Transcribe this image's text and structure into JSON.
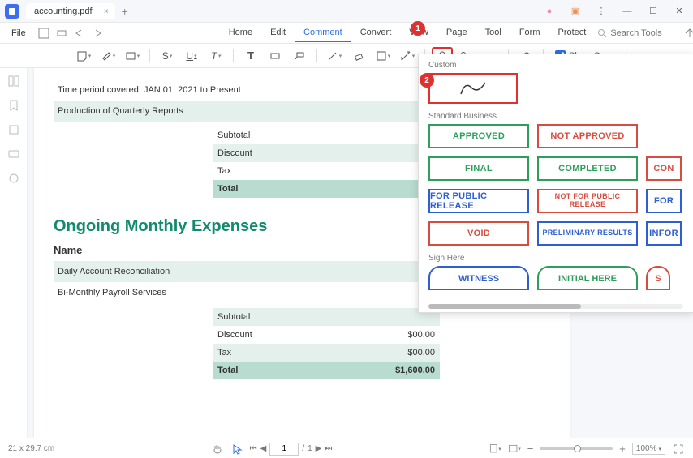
{
  "titlebar": {
    "tab_name": "accounting.pdf"
  },
  "menubar": {
    "file": "File",
    "items": [
      "Home",
      "Edit",
      "Comment",
      "Convert",
      "View",
      "Page",
      "Tool",
      "Form",
      "Protect"
    ],
    "active_index": 2,
    "search_placeholder": "Search Tools"
  },
  "toolbar": {
    "show_comment_label": "Show Comment"
  },
  "callouts": {
    "c1": "1",
    "c2": "2"
  },
  "stamp_panel": {
    "custom_label": "Custom",
    "standard_label": "Standard Business",
    "stamps_row1": [
      {
        "text": "APPROVED",
        "color": "#2e9e5b"
      },
      {
        "text": "NOT APPROVED",
        "color": "#d84c3f"
      }
    ],
    "stamps_row2": [
      {
        "text": "FINAL",
        "color": "#2e9e5b"
      },
      {
        "text": "COMPLETED",
        "color": "#2e9e5b"
      },
      {
        "text": "CON",
        "color": "#d84c3f"
      }
    ],
    "stamps_row3": [
      {
        "text": "FOR PUBLIC RELEASE",
        "color": "#2d5fd1"
      },
      {
        "text": "NOT FOR PUBLIC RELEASE",
        "color": "#d84c3f",
        "small": true
      },
      {
        "text": "FOR",
        "color": "#2d5fd1"
      }
    ],
    "stamps_row4": [
      {
        "text": "VOID",
        "color": "#d84c3f"
      },
      {
        "text": "PRELIMINARY RESULTS",
        "color": "#2d5fd1",
        "small": true
      },
      {
        "text": "INFOR",
        "color": "#2d5fd1"
      }
    ],
    "sign_label": "Sign Here",
    "sign_stamps": [
      {
        "text": "WITNESS",
        "color": "#2d5fd1"
      },
      {
        "text": "INITIAL HERE",
        "color": "#2e9e5b"
      },
      {
        "text": "S",
        "color": "#d84c3f"
      }
    ]
  },
  "document": {
    "time_period": "Time period covered: JAN 01, 2021 to Present",
    "production": "Production of Quarterly Reports",
    "totals1": {
      "subtotal_label": "Subtotal",
      "discount_label": "Discount",
      "tax_label": "Tax",
      "total_label": "Total"
    },
    "section_title": "Ongoing Monthly Expenses",
    "name_header": "Name",
    "items": [
      "Daily Account Reconciliation",
      "Bi-Monthly Payroll Services"
    ],
    "totals2": {
      "subtotal_label": "Subtotal",
      "subtotal_value": "",
      "discount_label": "Discount",
      "discount_value": "$00.00",
      "tax_label": "Tax",
      "tax_value": "$00.00",
      "total_label": "Total",
      "total_value": "$1,600.00"
    }
  },
  "statusbar": {
    "dimensions": "21 x 29.7 cm",
    "page_current": "1",
    "page_total": "1",
    "zoom": "100%"
  }
}
